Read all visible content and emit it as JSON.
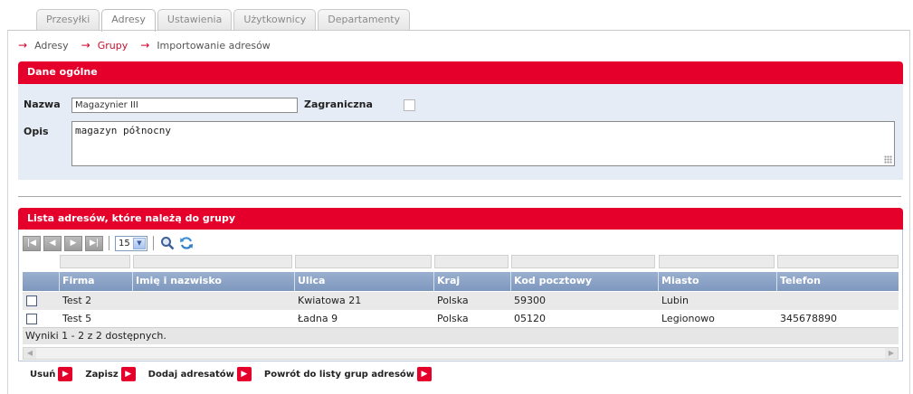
{
  "tabs": [
    {
      "label": "Przesyłki",
      "active": false
    },
    {
      "label": "Adresy",
      "active": true
    },
    {
      "label": "Ustawienia",
      "active": false
    },
    {
      "label": "Użytkownicy",
      "active": false
    },
    {
      "label": "Departamenty",
      "active": false
    }
  ],
  "breadcrumb": [
    {
      "label": "Adresy"
    },
    {
      "label": "Grupy"
    },
    {
      "label": "Importowanie adresów"
    }
  ],
  "general": {
    "title": "Dane ogólne",
    "name_label": "Nazwa",
    "name_value": "Magazynier III",
    "foreign_label": "Zagraniczna",
    "foreign_checked": false,
    "desc_label": "Opis",
    "desc_value": "magazyn północny"
  },
  "list": {
    "title": "Lista adresów, które należą do grupy",
    "page_size": "15",
    "columns": [
      "Firma",
      "Imię i nazwisko",
      "Ulica",
      "Kraj",
      "Kod pocztowy",
      "Miasto",
      "Telefon"
    ],
    "rows": [
      {
        "firma": "Test 2",
        "imie": "",
        "ulica": "Kwiatowa 21",
        "kraj": "Polska",
        "kod": "59300",
        "miasto": "Lubin",
        "telefon": ""
      },
      {
        "firma": "Test 5",
        "imie": "",
        "ulica": "Ładna 9",
        "kraj": "Polska",
        "kod": "05120",
        "miasto": "Legionowo",
        "telefon": "345678890"
      }
    ],
    "footer": "Wyniki 1 - 2 z 2 dostępnych."
  },
  "actions": {
    "delete": "Usuń",
    "save": "Zapisz",
    "add": "Dodaj adresatów",
    "back": "Powrót do listy grup adresów"
  },
  "colors": {
    "accent": "#e4002b",
    "header": "#8ea6c9",
    "panel": "#e6ecf5"
  }
}
